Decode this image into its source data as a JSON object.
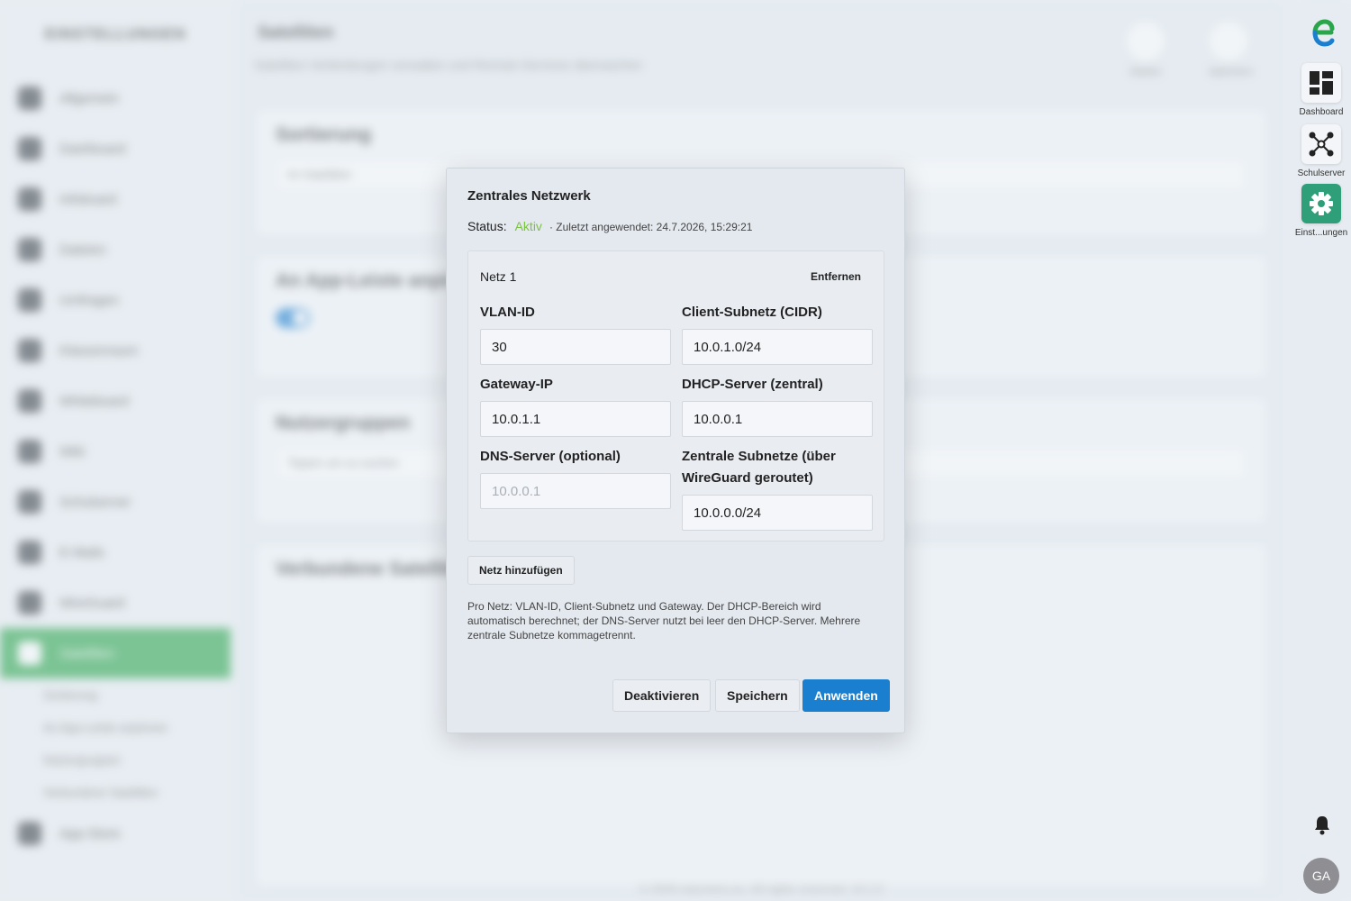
{
  "background": {
    "sidebar_title": "EINSTELLUNGEN",
    "sidebar_items": [
      "Allgemein",
      "Dashboard",
      "Infoboard",
      "Dateien",
      "Umfragen",
      "Klassenraum",
      "Whiteboard",
      "Wiki",
      "Schulserver",
      "E-Mails",
      "WireGuard",
      "Satelliten",
      "App-Store"
    ],
    "sidebar_subitems": [
      "Sortierung",
      "An App-Leiste anpinnen",
      "Nutzergruppen",
      "Verbundene Satelliten"
    ],
    "page_title": "Satelliten",
    "page_subtitle": "Satelliten-Verbindungen verwalten und Remote-Services überwachen",
    "top_buttons": [
      "Starten",
      "Speichern"
    ],
    "card_titles": [
      "Sortierung",
      "An App-Leiste anpinnen",
      "Nutzergruppen",
      "Verbundene Satelliten"
    ],
    "sort_value": "Im Satelliten",
    "search_placeholder": "Tippen um zu suchen",
    "footer": "© 2026 edunetos.eu. All rights reserved. v0.1.0"
  },
  "rail": {
    "items": [
      {
        "label": "Dashboard",
        "icon": "dashboard-icon"
      },
      {
        "label": "Schulserver",
        "icon": "network-icon"
      },
      {
        "label": "Einst...ungen",
        "icon": "gear-icon"
      }
    ],
    "avatar": "GA",
    "accent": "#2f9f7a"
  },
  "modal": {
    "title": "Zentrales Netzwerk",
    "status_label": "Status:",
    "status_value": "Aktiv",
    "status_time": "· Zuletzt angewendet: 24.7.2026, 15:29:21",
    "net": {
      "name": "Netz 1",
      "remove_label": "Entfernen",
      "vlan_label": "VLAN-ID",
      "vlan_value": "30",
      "subnet_label": "Client-Subnetz (CIDR)",
      "subnet_value": "10.0.1.0/24",
      "gateway_label": "Gateway-IP",
      "gateway_value": "10.0.1.1",
      "dhcp_label": "DHCP-Server (zentral)",
      "dhcp_value": "10.0.0.1",
      "dns_label": "DNS-Server (optional)",
      "dns_placeholder": "10.0.0.1",
      "central_label": "Zentrale Subnetze (über WireGuard geroutet)",
      "central_value": "10.0.0.0/24"
    },
    "add_label": "Netz hinzufügen",
    "help": "Pro Netz: VLAN-ID, Client-Subnetz und Gateway. Der DHCP-Bereich wird automatisch berechnet; der DNS-Server nutzt bei leer den DHCP-Server. Mehrere zentrale Subnetze kommagetrennt.",
    "deactivate_label": "Deaktivieren",
    "save_label": "Speichern",
    "apply_label": "Anwenden",
    "status_color": "#7cc242",
    "primary_color": "#1a7fcf"
  }
}
